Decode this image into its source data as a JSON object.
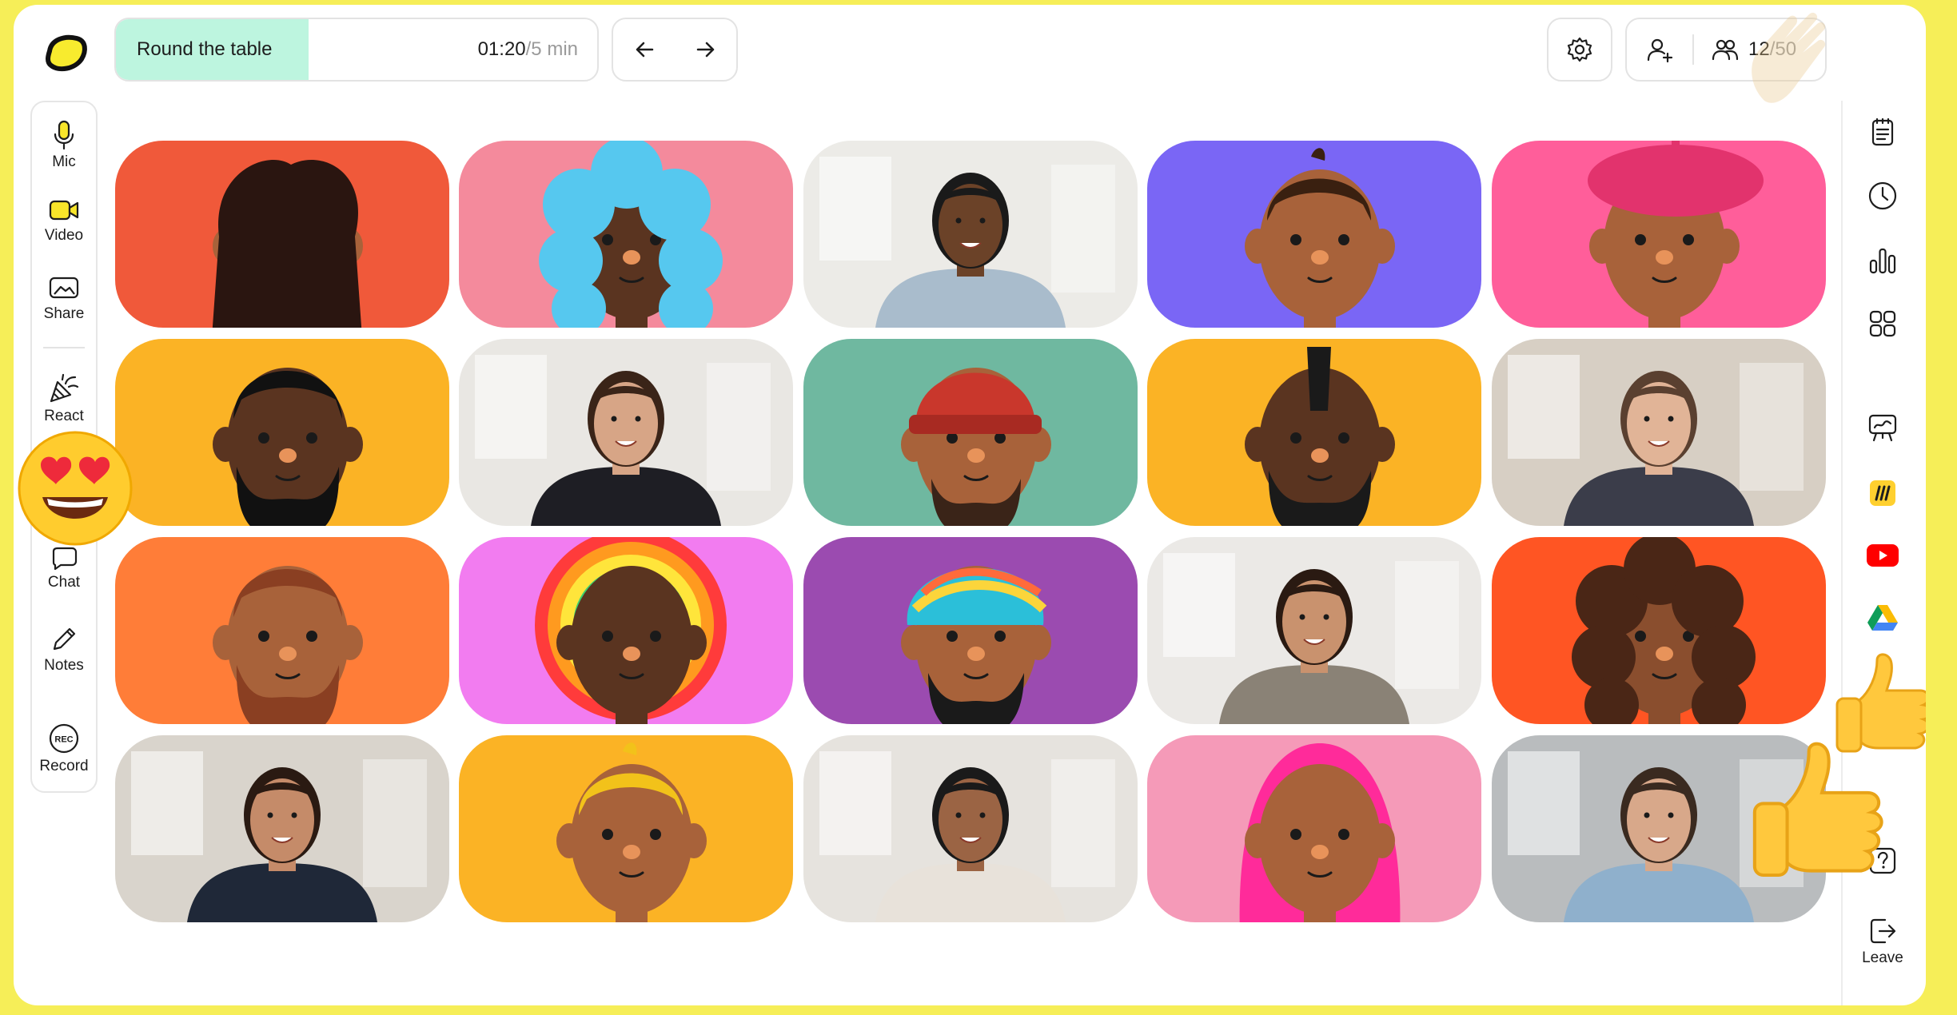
{
  "activity": {
    "label": "Round the table",
    "elapsed": "01:20",
    "total": "/5 min",
    "progress": 0.4
  },
  "participants": {
    "current": "12",
    "capacity": "/50"
  },
  "toolbar_left": {
    "mic": "Mic",
    "video": "Video",
    "share": "Share",
    "react": "React",
    "chat": "Chat",
    "notes": "Notes",
    "record": "Record",
    "record_badge": "REC"
  },
  "toolbar_right": {
    "leave": "Leave"
  },
  "colors": {
    "background": "#f6ee58",
    "progress": "#bdf5df",
    "youtube": "#ff0000",
    "miro": "#ffd02f"
  },
  "tiles": [
    {
      "kind": "avatar",
      "bg": "#f0593a",
      "skin": "#a8623a",
      "hair": "#2a1510",
      "style": "long"
    },
    {
      "kind": "avatar",
      "bg": "#f48a9c",
      "skin": "#5a3420",
      "hair": "#56c8ef",
      "style": "curly"
    },
    {
      "kind": "photo",
      "bg": "#ecebe7",
      "skin": "#6b4228",
      "shirt": "#a9bccc",
      "hair": "#1a1a1a"
    },
    {
      "kind": "avatar",
      "bg": "#7a66f5",
      "skin": "#a8623a",
      "hair": "#3a2010",
      "style": "short"
    },
    {
      "kind": "avatar",
      "bg": "#ff5e9a",
      "skin": "#a8623a",
      "hair": "#e2336d",
      "style": "beret"
    },
    {
      "kind": "avatar",
      "bg": "#fbb325",
      "skin": "#5a3420",
      "hair": "#111111",
      "style": "beard"
    },
    {
      "kind": "photo",
      "bg": "#e9e7e3",
      "skin": "#d7a586",
      "shirt": "#1e1e24",
      "hair": "#3a2418"
    },
    {
      "kind": "avatar",
      "bg": "#6fb8a0",
      "skin": "#a8623a",
      "hair": "#c9372c",
      "style": "beanie"
    },
    {
      "kind": "avatar",
      "bg": "#fbb325",
      "skin": "#5a3420",
      "hair": "#1a1a1a",
      "style": "mohawk"
    },
    {
      "kind": "photo",
      "bg": "#d7cfc4",
      "skin": "#e1b497",
      "shirt": "#3b3d4a",
      "hair": "#5a4030"
    },
    {
      "kind": "avatar",
      "bg": "#ff7d38",
      "skin": "#a8623a",
      "hair": "#8a3f22",
      "style": "beard"
    },
    {
      "kind": "avatar",
      "bg": "#f27cf0",
      "skin": "#5a3420",
      "hair": "#ff3b3b",
      "style": "rainbow"
    },
    {
      "kind": "avatar",
      "bg": "#9b4bb0",
      "skin": "#a8623a",
      "hair": "#2bbfd9",
      "style": "turban"
    },
    {
      "kind": "photo",
      "bg": "#ebe9e6",
      "skin": "#c9926e",
      "shirt": "#8a8276",
      "hair": "#2a1a12"
    },
    {
      "kind": "avatar",
      "bg": "#ff5523",
      "skin": "#8a4e2e",
      "hair": "#4a2616",
      "style": "curly"
    },
    {
      "kind": "photo",
      "bg": "#d9d4cc",
      "skin": "#c58b69",
      "shirt": "#1f2838",
      "hair": "#2a1a12"
    },
    {
      "kind": "avatar",
      "bg": "#fbb325",
      "skin": "#a8623a",
      "hair": "#f2c21a",
      "style": "short"
    },
    {
      "kind": "photo",
      "bg": "#e6e3de",
      "skin": "#9b6444",
      "shirt": "#e8e2da",
      "hair": "#1a1a1a"
    },
    {
      "kind": "avatar",
      "bg": "#f59ab8",
      "skin": "#a8623a",
      "hair": "#ff2b9a",
      "style": "hijab"
    },
    {
      "kind": "photo",
      "bg": "#b9bcbe",
      "skin": "#d8a88a",
      "shirt": "#8fb0cc",
      "hair": "#3a2a20"
    }
  ]
}
